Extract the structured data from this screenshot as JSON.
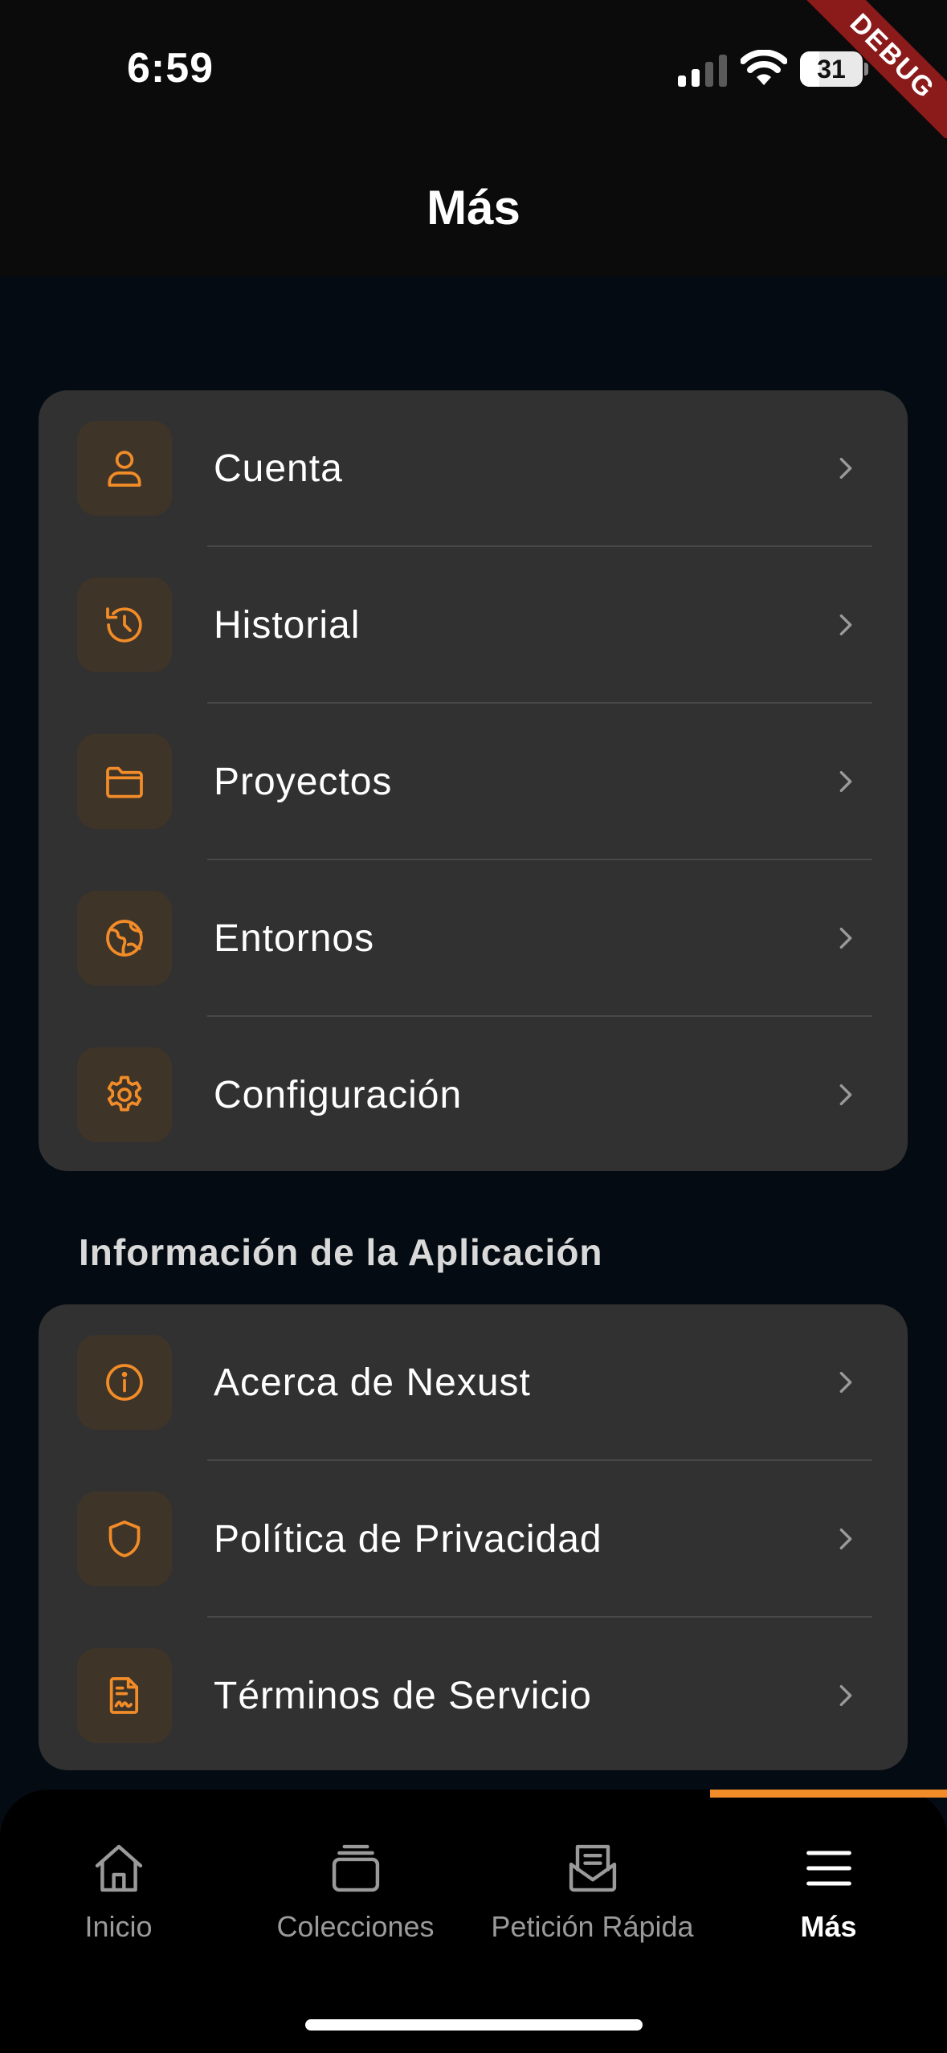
{
  "status_bar": {
    "time": "6:59",
    "battery_percent": "31",
    "battery_level": 0.31,
    "signal_icon": "cellular-signal-icon",
    "wifi_icon": "wifi-icon",
    "battery_icon": "battery-icon"
  },
  "debug_banner": "DEBUG",
  "header": {
    "title": "Más"
  },
  "main_menu": [
    {
      "label": "Cuenta",
      "icon": "user-icon"
    },
    {
      "label": "Historial",
      "icon": "history-icon"
    },
    {
      "label": "Proyectos",
      "icon": "folder-icon"
    },
    {
      "label": "Entornos",
      "icon": "globe-icon"
    },
    {
      "label": "Configuración",
      "icon": "gear-icon"
    }
  ],
  "app_info_section": {
    "title": "Información de la Aplicación",
    "items": [
      {
        "label": "Acerca de Nexust",
        "icon": "info-icon"
      },
      {
        "label": "Política de Privacidad",
        "icon": "shield-icon"
      },
      {
        "label": "Términos de Servicio",
        "icon": "document-signature-icon"
      }
    ]
  },
  "tab_bar": {
    "tabs": [
      {
        "label": "Inicio",
        "icon": "home-icon",
        "active": false
      },
      {
        "label": "Colecciones",
        "icon": "collections-icon",
        "active": false
      },
      {
        "label": "Petición Rápida",
        "icon": "quick-request-icon",
        "active": false
      },
      {
        "label": "Más",
        "icon": "menu-icon",
        "active": true
      }
    ]
  },
  "colors": {
    "accent": "#F28C28",
    "background": "#050B12",
    "card": "#313131",
    "icon_box": "#3F3428",
    "header": "#0B0B0B",
    "debug_ribbon": "#8B1A1A"
  }
}
